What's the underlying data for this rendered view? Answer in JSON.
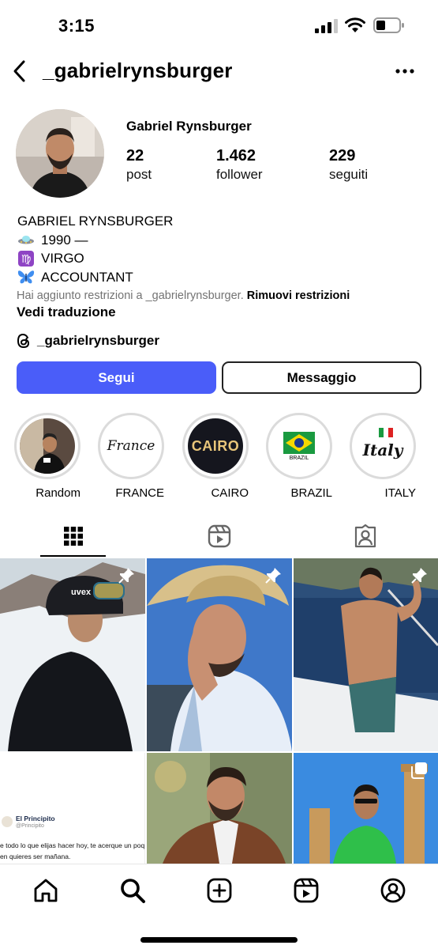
{
  "status_bar": {
    "time": "3:15"
  },
  "header": {
    "username": "_gabrielrynsburger"
  },
  "profile": {
    "full_name": "Gabriel Rynsburger",
    "stats": [
      {
        "value": "22",
        "label": "post"
      },
      {
        "value": "1.462",
        "label": "follower"
      },
      {
        "value": "229",
        "label": "seguiti"
      }
    ],
    "bio": {
      "name_line": "GABRIEL RYNSBURGER",
      "lines": [
        {
          "icon": "ufo-icon",
          "text": "1990 —"
        },
        {
          "icon": "virgo-icon",
          "text": "VIRGO"
        },
        {
          "icon": "butterfly-icon",
          "text": "ACCOUNTANT"
        }
      ]
    },
    "restriction_notice": "Hai aggiunto restrizioni a _gabrielrynsburger.",
    "remove_restrictions": "Rimuovi restrizioni",
    "see_translation": "Vedi traduzione",
    "threads_handle": "_gabrielrynsburger"
  },
  "actions": {
    "follow": "Segui",
    "message": "Messaggio"
  },
  "highlights": [
    {
      "label": "Random",
      "cover_text": ""
    },
    {
      "label": "FRANCE",
      "cover_text": "France"
    },
    {
      "label": "CAIRO",
      "cover_text": "CAIRO"
    },
    {
      "label": "BRAZIL",
      "cover_text": "BRAZIL"
    },
    {
      "label": "ITALY",
      "cover_text": "Italy"
    }
  ],
  "tabs": [
    {
      "name": "grid",
      "icon": "grid-icon",
      "active": true
    },
    {
      "name": "reels",
      "icon": "reels-icon",
      "active": false
    },
    {
      "name": "tagged",
      "icon": "tagged-icon",
      "active": false
    }
  ],
  "posts": [
    {
      "pinned": true,
      "overlay_text": "uvex"
    },
    {
      "pinned": true
    },
    {
      "pinned": true
    },
    {
      "pinned": false,
      "quote_author": "El Principito",
      "quote_handle": "@Principito",
      "quote_text_1": "e todo lo que elijas hacer hoy, te acerque un poquito a",
      "quote_text_2": "en quieres ser mañana."
    },
    {
      "pinned": false
    },
    {
      "pinned": false,
      "multi": true
    }
  ],
  "bottom_nav": [
    {
      "icon": "home-icon"
    },
    {
      "icon": "search-icon",
      "active": true
    },
    {
      "icon": "create-icon"
    },
    {
      "icon": "reels-icon"
    },
    {
      "icon": "profile-icon"
    }
  ],
  "colors": {
    "primary_button": "#4a5df9",
    "text_secondary": "#737373"
  }
}
